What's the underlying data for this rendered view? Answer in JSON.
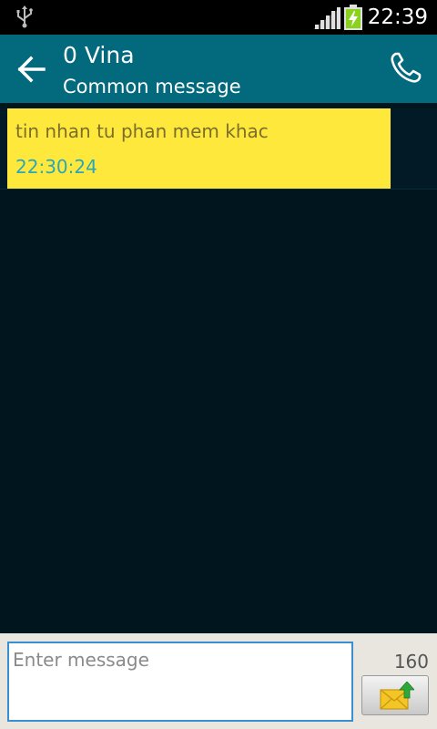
{
  "status_bar": {
    "time": "22:39",
    "icons": [
      "usb-icon",
      "signal-icon",
      "battery-charging-icon"
    ]
  },
  "header": {
    "contact_name": "0 Vina",
    "subtitle": "Common message",
    "icons": [
      "back-arrow-icon",
      "phone-icon"
    ]
  },
  "messages": [
    {
      "text": "tin nhan tu phan mem khac",
      "time": "22:30:24"
    }
  ],
  "compose": {
    "placeholder": "Enter message",
    "char_count": "160",
    "send_icon": "envelope-send-icon"
  },
  "colors": {
    "action_bar": "#036a7e",
    "background": "#01151f",
    "bubble": "#ffe83c",
    "timestamp": "#2aa7b8",
    "input_border": "#3a8fd0"
  }
}
